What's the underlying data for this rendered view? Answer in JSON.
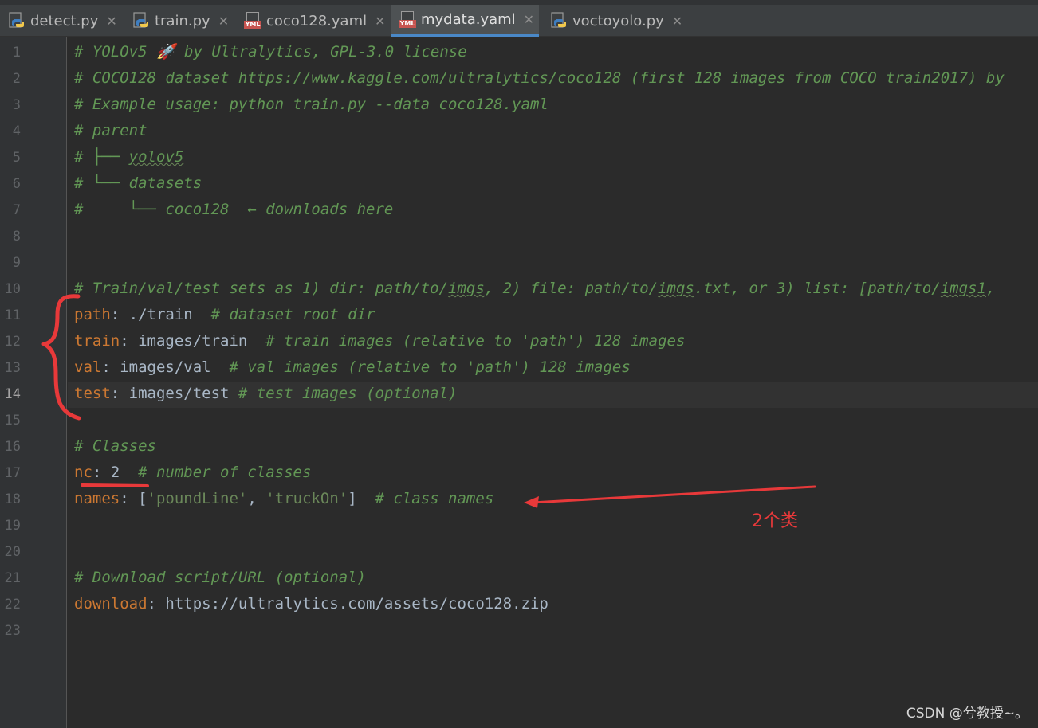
{
  "tabs": [
    {
      "label": "detect.py",
      "icon": "python-file-icon",
      "active": false
    },
    {
      "label": "train.py",
      "icon": "python-file-icon",
      "active": false
    },
    {
      "label": "coco128.yaml",
      "icon": "yaml-file-icon",
      "active": false
    },
    {
      "label": "mydata.yaml",
      "icon": "yaml-file-icon",
      "active": true
    },
    {
      "label": "voctoyolo.py",
      "icon": "python-file-icon",
      "active": false
    }
  ],
  "yaml_icon_label": "YML",
  "line_numbers": [
    "1",
    "2",
    "3",
    "4",
    "5",
    "6",
    "7",
    "8",
    "9",
    "10",
    "11",
    "12",
    "13",
    "14",
    "15",
    "16",
    "17",
    "18",
    "19",
    "20",
    "21",
    "22",
    "23"
  ],
  "current_line": "14",
  "code": {
    "l1": "# YOLOv5 🚀 by Ultralytics, GPL-3.0 license",
    "l2a": "# COCO128 dataset ",
    "l2b": "https://www.kaggle.com/ultralytics/coco128",
    "l2c": " (first 128 images from COCO train2017) by",
    "l3": "# Example usage: python train.py --data coco128.yaml",
    "l4": "# parent",
    "l5a": "# ├── ",
    "l5b": "yolov5",
    "l6": "# └── datasets",
    "l7": "#     └── coco128  ← downloads here",
    "l10a": "# Train/val/test sets as 1) dir: path/to/",
    "l10b": "imgs",
    "l10c": ", 2) file: path/to/",
    "l10d": "imgs",
    "l10e": ".txt, or 3) list: [path/to/",
    "l10f": "imgs1",
    "l10g": ",",
    "l11k": "path",
    "l11v": ": ./train  ",
    "l11c": "# dataset root dir",
    "l12k": "train",
    "l12v": ": images/train  ",
    "l12c": "# train images (relative to 'path') 128 images",
    "l13k": "val",
    "l13v": ": images/val  ",
    "l13c": "# val images (relative to 'path') 128 images",
    "l14k": "test",
    "l14v": ": images/test ",
    "l14c": "# test images (optional)",
    "l16": "# Classes",
    "l17k": "nc",
    "l17v": ": 2  ",
    "l17c": "# number of classes",
    "l18k": "names",
    "l18a": ": [",
    "l18s1": "'poundLine'",
    "l18b": ", ",
    "l18s2": "'truckOn'",
    "l18c": "]  ",
    "l18d": "# class names",
    "l21": "# Download script/URL (optional)",
    "l22k": "download",
    "l22v": ": https://ultralytics.com/assets/coco128.zip"
  },
  "annotation_text": "2个类",
  "watermark": "CSDN @兮教授~。",
  "colors": {
    "background": "#2b2b2b",
    "comment": "#629755",
    "key": "#cc7832",
    "string": "#6a8759",
    "text": "#a9b7c6",
    "annotation": "#e8393a"
  }
}
